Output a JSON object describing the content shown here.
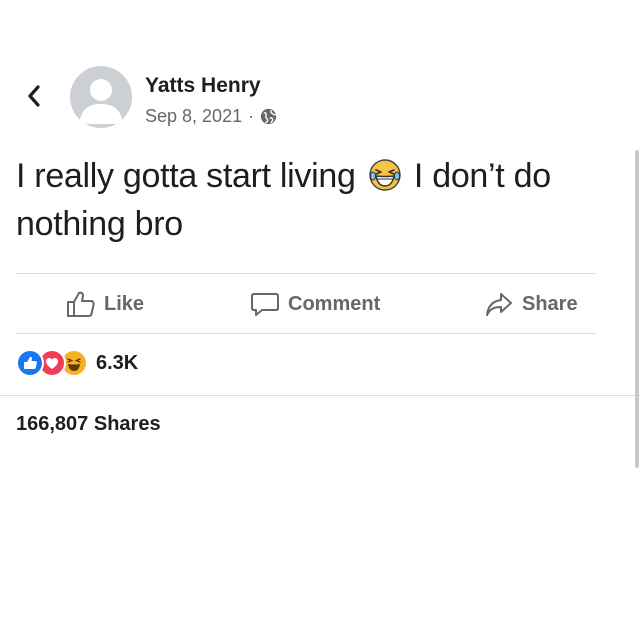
{
  "post": {
    "author": "Yatts Henry",
    "date": "Sep 8, 2021",
    "separator": "·",
    "audience_icon": "globe-icon",
    "text_before_emoji": "I really gotta start living",
    "emoji": "face-with-tears-of-joy",
    "text_after_emoji": "I don’t do nothing bro"
  },
  "actions": {
    "like_label": "Like",
    "comment_label": "Comment",
    "share_label": "Share"
  },
  "stats": {
    "reaction_icons": [
      "like",
      "love",
      "haha"
    ],
    "reaction_count": "6.3K",
    "shares": "166,807 Shares"
  },
  "colors": {
    "text": "#1c1e21",
    "secondary_text": "#65676b",
    "divider": "#dadde1",
    "like_blue": "#1877f2",
    "love_red": "#f33e58",
    "haha_yellow": "#f7b125"
  }
}
